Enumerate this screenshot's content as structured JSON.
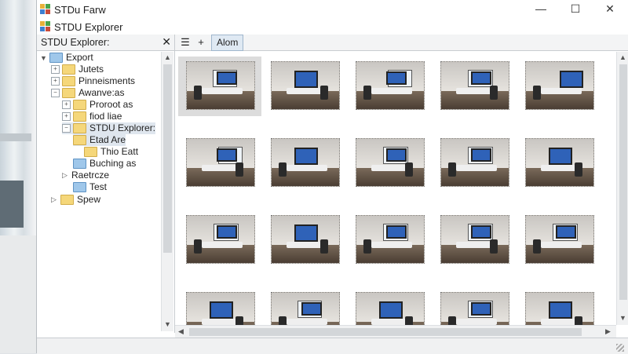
{
  "window": {
    "title": "STDu Farw",
    "subtitle": "STDU Explorer",
    "controls": {
      "minimize": "—",
      "maximize": "☐",
      "close": "✕"
    }
  },
  "left_pane": {
    "header": "STDU   Explorer:",
    "close": "✕",
    "tree": [
      {
        "label": "Export",
        "indent": 0,
        "toggle": "▼",
        "folder": "blue",
        "selected": false
      },
      {
        "label": "Jutets",
        "indent": 1,
        "toggle": "⊞",
        "folder": "yellow",
        "selected": false
      },
      {
        "label": "Pinneisments",
        "indent": 1,
        "toggle": "⊞",
        "folder": "yellow",
        "selected": false
      },
      {
        "label": "Awanve:as",
        "indent": 1,
        "toggle": "⊟",
        "folder": "yellow",
        "selected": false
      },
      {
        "label": "Proroot as",
        "indent": 2,
        "toggle": "⊞",
        "folder": "yellow",
        "selected": false
      },
      {
        "label": "fiod liae",
        "indent": 2,
        "toggle": "⊞",
        "folder": "yellow",
        "selected": false
      },
      {
        "label": "STDU Explorer:",
        "indent": 2,
        "toggle": "⊟",
        "folder": "yellow",
        "selected": true
      },
      {
        "label": "Etad Are",
        "indent": 3,
        "toggle": "",
        "folder": "yellow",
        "selected": true
      },
      {
        "label": "Thio Eatt",
        "indent": 4,
        "toggle": "",
        "folder": "yellow",
        "selected": false
      },
      {
        "label": "Buching as",
        "indent": 3,
        "toggle": "",
        "folder": "blue",
        "selected": false
      },
      {
        "label": "Raetrcze",
        "indent": 2,
        "toggle": "▷",
        "folder": "none",
        "selected": false
      },
      {
        "label": "Test",
        "indent": 3,
        "toggle": "",
        "folder": "blue",
        "selected": false
      },
      {
        "label": "Spew",
        "indent": 1,
        "toggle": "▷",
        "folder": "yellow",
        "selected": false
      }
    ]
  },
  "toolbar": {
    "list_icon": "☰",
    "add_icon": "+",
    "tab_label": "Alom"
  },
  "thumbnails": [
    {
      "row": 0,
      "col": 0,
      "selected": true,
      "variant": "window-left"
    },
    {
      "row": 0,
      "col": 1,
      "selected": false,
      "variant": "screen-center"
    },
    {
      "row": 0,
      "col": 2,
      "selected": false,
      "variant": "window-right"
    },
    {
      "row": 0,
      "col": 3,
      "selected": false,
      "variant": "window-center"
    },
    {
      "row": 0,
      "col": 4,
      "selected": false,
      "variant": "screen-right"
    },
    {
      "row": 1,
      "col": 0,
      "selected": false,
      "variant": "window-right"
    },
    {
      "row": 1,
      "col": 1,
      "selected": false,
      "variant": "screen-center"
    },
    {
      "row": 1,
      "col": 2,
      "selected": false,
      "variant": "window-center"
    },
    {
      "row": 1,
      "col": 3,
      "selected": false,
      "variant": "window-center"
    },
    {
      "row": 1,
      "col": 4,
      "selected": false,
      "variant": "screen-center"
    },
    {
      "row": 2,
      "col": 0,
      "selected": false,
      "variant": "window-center"
    },
    {
      "row": 2,
      "col": 1,
      "selected": false,
      "variant": "screen-center"
    },
    {
      "row": 2,
      "col": 2,
      "selected": false,
      "variant": "window-center"
    },
    {
      "row": 2,
      "col": 3,
      "selected": false,
      "variant": "window-center"
    },
    {
      "row": 2,
      "col": 4,
      "selected": false,
      "variant": "window-center"
    },
    {
      "row": 3,
      "col": 0,
      "selected": false,
      "variant": "screen-center"
    },
    {
      "row": 3,
      "col": 1,
      "selected": false,
      "variant": "window-left"
    },
    {
      "row": 3,
      "col": 2,
      "selected": false,
      "variant": "screen-center"
    },
    {
      "row": 3,
      "col": 3,
      "selected": false,
      "variant": "window-center"
    },
    {
      "row": 3,
      "col": 4,
      "selected": false,
      "variant": "screen-center"
    }
  ],
  "colors": {
    "accent": "#9fb6cc",
    "selection": "#dfe6ee",
    "folder_yellow": "#f5d77a",
    "folder_blue": "#9fc7ea"
  }
}
